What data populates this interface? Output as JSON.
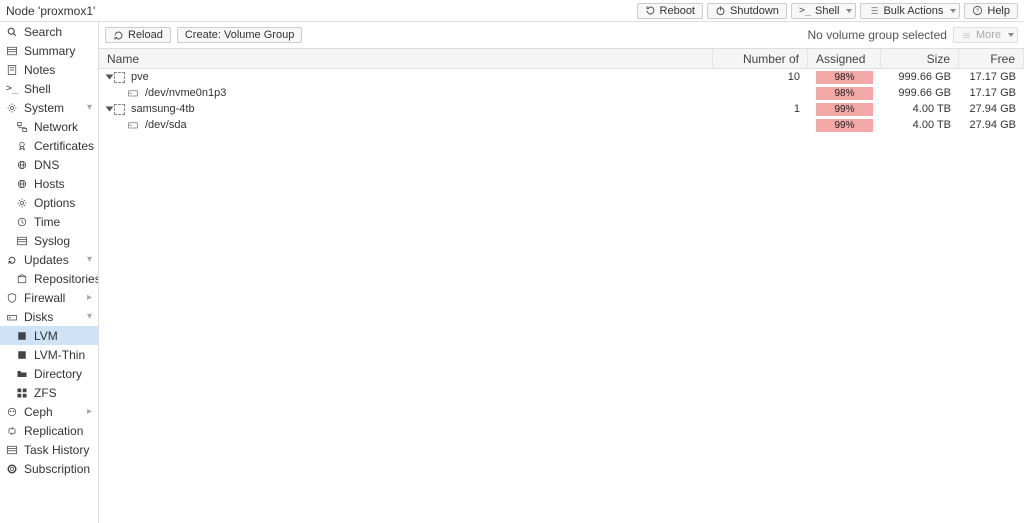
{
  "header": {
    "title": "Node 'proxmox1'",
    "buttons": {
      "reboot": "Reboot",
      "shutdown": "Shutdown",
      "shell": "Shell",
      "bulk": "Bulk Actions",
      "help": "Help"
    }
  },
  "sidebar": {
    "items": [
      {
        "label": "Search",
        "icon": "search"
      },
      {
        "label": "Summary",
        "icon": "list"
      },
      {
        "label": "Notes",
        "icon": "note"
      },
      {
        "label": "Shell",
        "icon": "shell"
      },
      {
        "label": "System",
        "icon": "gear",
        "exp": "▾"
      },
      {
        "label": "Network",
        "icon": "net",
        "lvl": 2
      },
      {
        "label": "Certificates",
        "icon": "cert",
        "lvl": 2
      },
      {
        "label": "DNS",
        "icon": "globe",
        "lvl": 2
      },
      {
        "label": "Hosts",
        "icon": "globe",
        "lvl": 2
      },
      {
        "label": "Options",
        "icon": "gear",
        "lvl": 2
      },
      {
        "label": "Time",
        "icon": "clock",
        "lvl": 2
      },
      {
        "label": "Syslog",
        "icon": "list",
        "lvl": 2
      },
      {
        "label": "Updates",
        "icon": "refresh",
        "exp": "▾"
      },
      {
        "label": "Repositories",
        "icon": "box",
        "lvl": 2
      },
      {
        "label": "Firewall",
        "icon": "shield",
        "exp": "▸"
      },
      {
        "label": "Disks",
        "icon": "hdd",
        "exp": "▾"
      },
      {
        "label": "LVM",
        "icon": "sq",
        "lvl": 2,
        "sel": true
      },
      {
        "label": "LVM-Thin",
        "icon": "sq",
        "lvl": 2
      },
      {
        "label": "Directory",
        "icon": "folder",
        "lvl": 2
      },
      {
        "label": "ZFS",
        "icon": "th",
        "lvl": 2
      },
      {
        "label": "Ceph",
        "icon": "ceph",
        "exp": "▸"
      },
      {
        "label": "Replication",
        "icon": "retweet"
      },
      {
        "label": "Task History",
        "icon": "list"
      },
      {
        "label": "Subscription",
        "icon": "support"
      }
    ]
  },
  "toolbar": {
    "reload": "Reload",
    "create": "Create: Volume Group",
    "status": "No volume group selected",
    "more": "More"
  },
  "columns": {
    "name": "Name",
    "lvs": "Number of LVs",
    "assigned": "Assigned to LVs",
    "size": "Size",
    "free": "Free"
  },
  "rows": [
    {
      "type": "vg",
      "name": "pve",
      "lvs": "10",
      "assigned_pct": "98%",
      "size": "999.66 GB",
      "free": "17.17 GB"
    },
    {
      "type": "disk",
      "name": "/dev/nvme0n1p3",
      "assigned_pct": "98%",
      "size": "999.66 GB",
      "free": "17.17 GB"
    },
    {
      "type": "vg",
      "name": "samsung-4tb",
      "lvs": "1",
      "assigned_pct": "99%",
      "size": "4.00 TB",
      "free": "27.94 GB"
    },
    {
      "type": "disk",
      "name": "/dev/sda",
      "assigned_pct": "99%",
      "size": "4.00 TB",
      "free": "27.94 GB"
    }
  ]
}
